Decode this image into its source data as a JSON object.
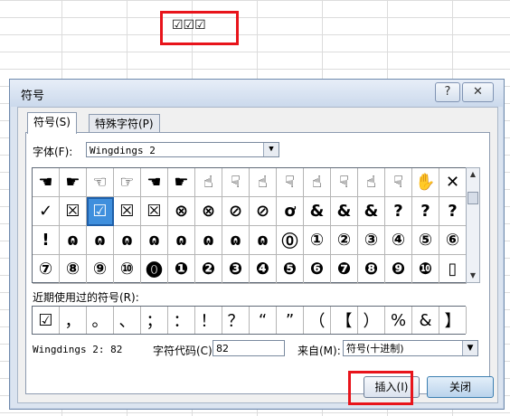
{
  "sheet": {
    "cell_text": "☑☑☑"
  },
  "dialog": {
    "title": "符号",
    "help_label": "?",
    "close_label": "✕",
    "tabs": [
      {
        "label": "符号(S)"
      },
      {
        "label": "特殊字符(P)"
      }
    ],
    "font_label": "字体(F):",
    "font_value": "Wingdings 2",
    "symbol_rows": [
      [
        "☚",
        "☛",
        "☜",
        "☞",
        "☚",
        "☛",
        "☝",
        "☟",
        "☝",
        "☟",
        "☝",
        "☟",
        "☝",
        "☟",
        "✋",
        "✕"
      ],
      [
        "✓",
        "☒",
        "☑",
        "☒",
        "☒",
        "⊗",
        "⊗",
        "⊘",
        "⊘",
        "ơ",
        "&",
        "&",
        "&",
        "?",
        "?",
        "?"
      ],
      [
        "!",
        "ɷ",
        "ɷ",
        "ɷ",
        "ɷ",
        "ɷ",
        "ɷ",
        "ɷ",
        "ɷ",
        "⓪",
        "①",
        "②",
        "③",
        "④",
        "⑤",
        "⑥"
      ],
      [
        "⑦",
        "⑧",
        "⑨",
        "⑩",
        "⓿",
        "❶",
        "❷",
        "❸",
        "❹",
        "❺",
        "❻",
        "❼",
        "❽",
        "❾",
        "❿",
        "▯"
      ]
    ],
    "selected_symbol": "☑",
    "recent_label": "近期使用过的符号(R):",
    "recent_symbols": [
      "☑",
      "，",
      "。",
      "、",
      "；",
      "：",
      "！",
      "？",
      "“",
      "”",
      "（",
      "【",
      "）",
      "%",
      "&",
      "】"
    ],
    "status_text": "Wingdings 2: 82",
    "code_label": "字符代码(C):",
    "code_value": "82",
    "from_label": "来自(M):",
    "from_value": "符号(十进制)",
    "insert_label": "插入(I)",
    "cancel_label": "关闭"
  },
  "colors": {
    "highlight_box": "#e8141b",
    "selection": "#3f8fdd"
  },
  "icons": {
    "dropdown": "chevron-down-icon",
    "scroll_up": "arrow-up-icon",
    "scroll_down": "arrow-down-icon"
  }
}
